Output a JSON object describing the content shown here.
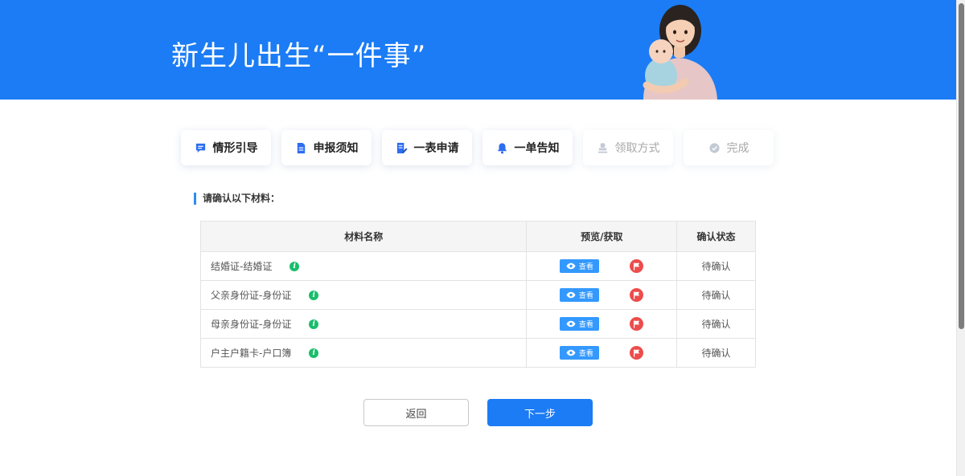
{
  "banner": {
    "title": "新生儿出生“一件事”"
  },
  "steps": [
    {
      "label": "情形引导",
      "icon": "chat-icon",
      "active": true
    },
    {
      "label": "申报须知",
      "icon": "document-icon",
      "active": true
    },
    {
      "label": "一表申请",
      "icon": "edit-form-icon",
      "active": true
    },
    {
      "label": "一单告知",
      "icon": "bell-icon",
      "active": true
    },
    {
      "label": "领取方式",
      "icon": "stamp-icon",
      "active": false
    },
    {
      "label": "完成",
      "icon": "check-circle-icon",
      "active": false
    }
  ],
  "section": {
    "title": "请确认以下材料："
  },
  "table": {
    "headers": {
      "name": "材料名称",
      "preview": "预览/获取",
      "status": "确认状态"
    },
    "view_label": "查看",
    "rows": [
      {
        "name": "结婚证-结婚证",
        "status": "待确认"
      },
      {
        "name": "父亲身份证-身份证",
        "status": "待确认"
      },
      {
        "name": "母亲身份证-身份证",
        "status": "待确认"
      },
      {
        "name": "户主户籍卡-户口簿",
        "status": "待确认"
      }
    ]
  },
  "actions": {
    "back_label": "返回",
    "next_label": "下一步"
  },
  "colors": {
    "primary": "#1b7cf5",
    "info_green": "#19be6b",
    "flag_red": "#ed4c4c",
    "view_blue": "#3399ff"
  }
}
